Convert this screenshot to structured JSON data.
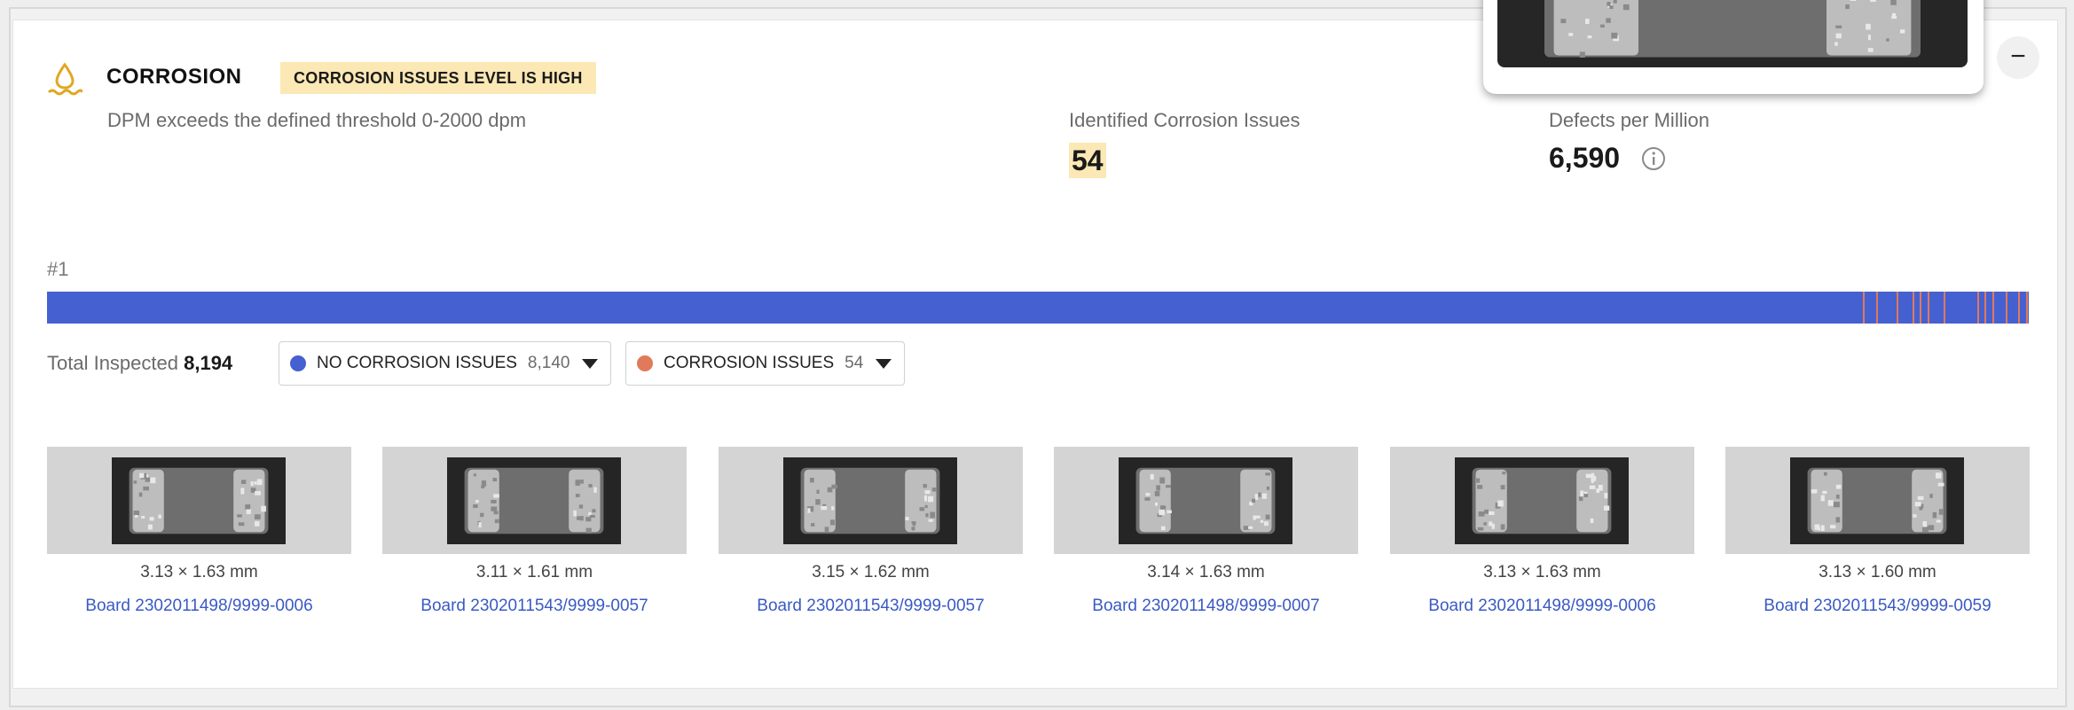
{
  "header": {
    "title": "CORROSION",
    "level_badge": "CORROSION ISSUES LEVEL IS HIGH",
    "description": "DPM exceeds the defined threshold 0-2000 dpm"
  },
  "metrics": {
    "identified_label": "Identified Corrosion Issues",
    "identified_value": "54",
    "dpm_label": "Defects per Million",
    "dpm_value": "6,590"
  },
  "distribution": {
    "rank": "#1",
    "total_label": "Total Inspected",
    "total_value": "8,194",
    "colors": {
      "ok": "#4560d1",
      "issue": "#e07a5a"
    },
    "filters": [
      {
        "label": "NO CORROSION ISSUES",
        "count": "8,140",
        "color": "#4560d1"
      },
      {
        "label": "CORROSION ISSUES",
        "count": "54",
        "color": "#e07a5a"
      }
    ]
  },
  "icons": {
    "header": "droplet-icon",
    "info": "info-icon",
    "collapse": "minus-icon",
    "dropdown": "caret-down-icon"
  },
  "thumbnails": [
    {
      "dimensions": "3.13 × 1.63 mm",
      "board": "Board 2302011498/9999-0006"
    },
    {
      "dimensions": "3.11 × 1.61 mm",
      "board": "Board 2302011543/9999-0057"
    },
    {
      "dimensions": "3.15 × 1.62 mm",
      "board": "Board 2302011543/9999-0057"
    },
    {
      "dimensions": "3.14 × 1.63 mm",
      "board": "Board 2302011498/9999-0007"
    },
    {
      "dimensions": "3.13 × 1.63 mm",
      "board": "Board 2302011498/9999-0006"
    },
    {
      "dimensions": "3.13 × 1.60 mm",
      "board": "Board 2302011543/9999-0059"
    }
  ]
}
